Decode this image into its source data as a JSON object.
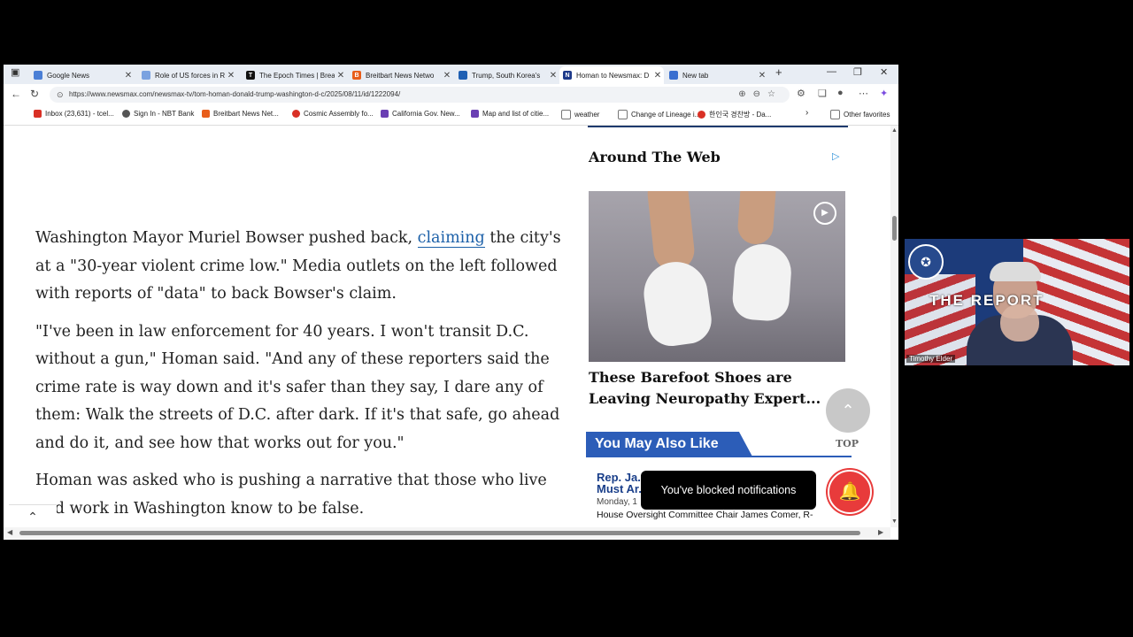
{
  "browser": {
    "tabs": [
      {
        "title": "Google News",
        "color": "#4a7fd6"
      },
      {
        "title": "Role of US forces in RO",
        "color": "#7aa2e0"
      },
      {
        "title": "The Epoch Times | Brea",
        "color": "#111111"
      },
      {
        "title": "Breitbart News Netwo",
        "color": "#e85d1a"
      },
      {
        "title": "Trump, South Korea's",
        "color": "#1e5fb3"
      },
      {
        "title": "Homan to Newsmax: D",
        "color": "#1e3a8a",
        "active": true
      },
      {
        "title": "New tab",
        "color": "#3a6fd0"
      }
    ],
    "new_tab_symbol": "+",
    "url": "https://www.newsmax.com/newsmax-tv/tom-homan-donald-trump-washington-d-c/2025/08/11/id/1222094/",
    "bookmarks": [
      {
        "label": "Inbox (23,631) - tcel...",
        "color": "#d93025"
      },
      {
        "label": "Sign In - NBT Bank",
        "color": "#555555"
      },
      {
        "label": "Breitbart News Net...",
        "color": "#e85d1a"
      },
      {
        "label": "Cosmic Assembly fo...",
        "color": "#d93025"
      },
      {
        "label": "California Gov. New...",
        "color": "#6a3fb3"
      },
      {
        "label": "Map and list of citie...",
        "color": "#6a3fb3"
      },
      {
        "label": "weather",
        "color": "#777777"
      },
      {
        "label": "Change of Lineage i...",
        "color": "#777777"
      },
      {
        "label": "한인국 경찬방 - Da...",
        "color": "#d93025"
      }
    ],
    "other_favorites": "Other favorites"
  },
  "article": {
    "p1_before": "Washington Mayor Muriel Bowser pushed back, ",
    "p1_link": "claiming",
    "p1_after": " the city's at a \"30-year violent crime low.\" Media outlets on the left followed with reports of \"data\" to back Bowser's claim.",
    "p2": "\"I've been in law enforcement for 40 years. I won't transit D.C. without a gun,\" Homan said. \"And any of these reporters said the crime rate is way down and it's safer than they say, I dare any of them: Walk the streets of D.C. after dark. If it's that safe, go ahead and do it, and see how that works out for you.\"",
    "p3": "Homan was asked who is pushing a narrative that those who live and work in Washington know to be false."
  },
  "sidebar": {
    "around_the_web": "Around The Web",
    "ad_title_line1": "These Barefoot Shoes are",
    "ad_title_line2": "Leaving Neuropathy Expert...",
    "you_may_also_like": "You May Also Like",
    "top_label": "TOP",
    "story_title": "Rep. Ja... Must Ar...",
    "story_date": "Monday, 1",
    "story_text": "House Oversight Committee Chair James Comer, R-"
  },
  "toast": {
    "message": "You've blocked notifications"
  },
  "webcam": {
    "report_title": "THE   REPORT",
    "name": "Timothy Elder"
  }
}
